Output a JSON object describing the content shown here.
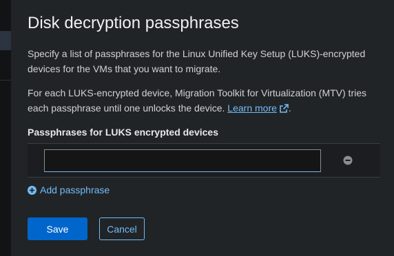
{
  "modal": {
    "title": "Disk decryption passphrases",
    "description_1": "Specify a list of passphrases for the Linux Unified Key Setup (LUKS)-encrypted devices for the VMs that you want to migrate.",
    "description_2_prefix": "For each LUKS-encrypted device, Migration Toolkit for Virtualization (MTV) tries each passphrase until one unlocks the device.",
    "learn_more_label": "Learn more",
    "description_2_suffix": ".",
    "field_label": "Passphrases for LUKS encrypted devices",
    "passphrase_value": "",
    "add_passphrase_label": "Add passphrase",
    "save_label": "Save",
    "cancel_label": "Cancel"
  },
  "colors": {
    "modal_bg": "#212427",
    "link": "#73bcf7",
    "primary": "#0066cc",
    "row_bg": "#1b1d21"
  },
  "icons": {
    "external_link": "external-link-icon",
    "remove": "minus-circle-icon",
    "add": "plus-circle-icon"
  }
}
